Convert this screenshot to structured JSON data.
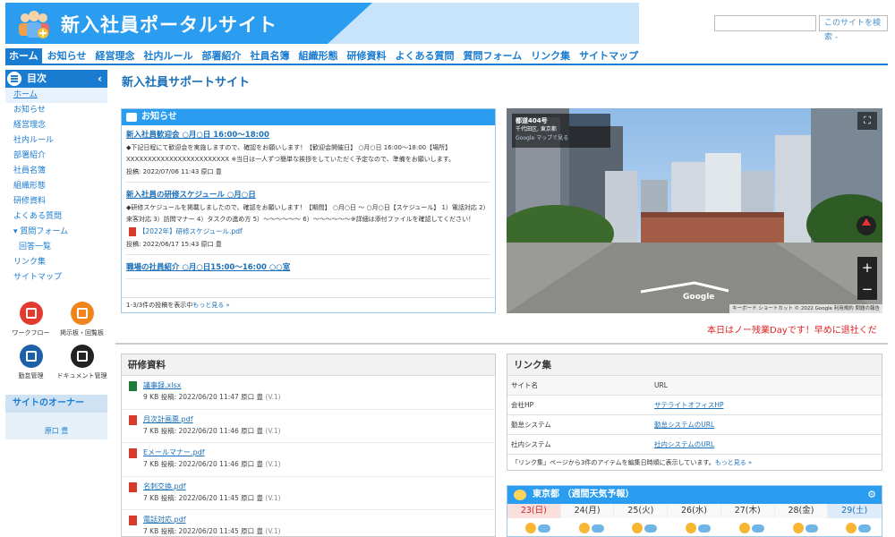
{
  "site": {
    "title": "新入社員ポータルサイト",
    "search_placeholder": "",
    "search_button": "このサイトを検索 -"
  },
  "nav": [
    "ホーム",
    "お知らせ",
    "経営理念",
    "社内ルール",
    "部署紹介",
    "社員名簿",
    "組織形態",
    "研修資料",
    "よくある質問",
    "質問フォーム",
    "リンク集",
    "サイトマップ"
  ],
  "sidebar": {
    "header": "目次",
    "items": [
      {
        "label": "ホーム",
        "selected": true,
        "sub": false
      },
      {
        "label": "お知らせ",
        "sub": false
      },
      {
        "label": "経営理念",
        "sub": false
      },
      {
        "label": "社内ルール",
        "sub": false
      },
      {
        "label": "部署紹介",
        "sub": false
      },
      {
        "label": "社員名簿",
        "sub": false
      },
      {
        "label": "組織形態",
        "sub": false
      },
      {
        "label": "研修資料",
        "sub": false
      },
      {
        "label": "よくある質問",
        "sub": false
      },
      {
        "label": "▾ 質問フォーム",
        "sub": false
      },
      {
        "label": "回答一覧",
        "sub": true
      },
      {
        "label": "リンク集",
        "sub": false
      },
      {
        "label": "サイトマップ",
        "sub": false
      }
    ],
    "apps": [
      {
        "label": "ワークフロー",
        "color": "#e23b2e"
      },
      {
        "label": "掲示板・回覧板",
        "color": "#f0851e"
      },
      {
        "label": "勤怠管理",
        "color": "#1d5fa8"
      },
      {
        "label": "ドキュメント管理",
        "color": "#222222"
      }
    ],
    "owner_header": "サイトのオーナー",
    "owner_name": "原口 豊"
  },
  "page_title": "新入社員サポートサイト",
  "news": {
    "header": "お知らせ",
    "articles": [
      {
        "title": "新入社員歓迎会 ○月○日 16:00～18:00",
        "text": "◆下記日程にて歓迎会を実施しますので、確認をお願いします！【歓迎会開催日】 ○月○日 16:00～18:00【場所】 XXXXXXXXXXXXXXXXXXXXXXXX ※当日は一人ずつ簡単な挨拶をしていただく予定なので、準備をお願いします。",
        "attachment": "",
        "meta": "投稿: 2022/07/06 11:43 原口 豊"
      },
      {
        "title": "新入社員の研修スケジュール ○月○日",
        "text": "◆研修スケジュールを掲載しましたので、確認をお願いします！【期間】 ○月○日 ～ ○月○日【スケジュール】 1）電話対応 2）来客対応 3）訪問マナー 4）タスクの進め方 5）～～～～～～ 6）～～～～～～※詳細は添付ファイルを確認してください！",
        "attachment": "【2022年】研修スケジュール.pdf",
        "meta": "投稿: 2022/06/17 15:43 原口 豊"
      },
      {
        "title": "職場の社員紹介 ○月○日15:00～16:00 ○○室",
        "text": "",
        "attachment": "",
        "meta": ""
      }
    ],
    "footer_count": "1-3/3件の投稿を表示中",
    "footer_more": "もっと見る »"
  },
  "streetview": {
    "place": "都道404号",
    "address": "千代田区, 東京都",
    "link": "Google マップで見る",
    "brand": "Google",
    "footer": "キーボード ショートカット © 2022 Google 利用規約 問題の報告"
  },
  "marquee": "本日はノー残業Dayです！早めに退社くだ",
  "docs": {
    "header": "研修資料",
    "items": [
      {
        "name": "議事録.xlsx",
        "size": "9 KB",
        "posted": "投稿: 2022/06/20 11:47 原口 豊",
        "version": "(V.1)",
        "type": "xlsx"
      },
      {
        "name": "月次計画票.pdf",
        "size": "7 KB",
        "posted": "投稿: 2022/06/20 11:46 原口 豊",
        "version": "(V.1)",
        "type": "pdf"
      },
      {
        "name": "Eメールマナー.pdf",
        "size": "7 KB",
        "posted": "投稿: 2022/06/20 11:46 原口 豊",
        "version": "(V.1)",
        "type": "pdf"
      },
      {
        "name": "名刺交換.pdf",
        "size": "7 KB",
        "posted": "投稿: 2022/06/20 11:45 原口 豊",
        "version": "(V.1)",
        "type": "pdf"
      },
      {
        "name": "電話対応.pdf",
        "size": "7 KB",
        "posted": "投稿: 2022/06/20 11:45 原口 豊",
        "version": "(V.1)",
        "type": "pdf"
      }
    ]
  },
  "links": {
    "header": "リンク集",
    "columns": [
      "サイト名",
      "URL"
    ],
    "rows": [
      {
        "name": "会社HP",
        "url": "サテライトオフィスHP"
      },
      {
        "name": "勤怠システム",
        "url": "勤怠システムのURL"
      },
      {
        "name": "社内システム",
        "url": "社内システムのURL"
      }
    ],
    "note": "「リンク集」ページから3件のアイテムを編集日時順に表示しています。",
    "more": "もっと見る »"
  },
  "weather": {
    "header": "東京都 （週間天気予報）",
    "days": [
      {
        "label": "23(日)",
        "kind": "sun"
      },
      {
        "label": "24(月)",
        "kind": ""
      },
      {
        "label": "25(火)",
        "kind": ""
      },
      {
        "label": "26(水)",
        "kind": ""
      },
      {
        "label": "27(木)",
        "kind": ""
      },
      {
        "label": "28(金)",
        "kind": ""
      },
      {
        "label": "29(土)",
        "kind": "sat"
      }
    ]
  }
}
